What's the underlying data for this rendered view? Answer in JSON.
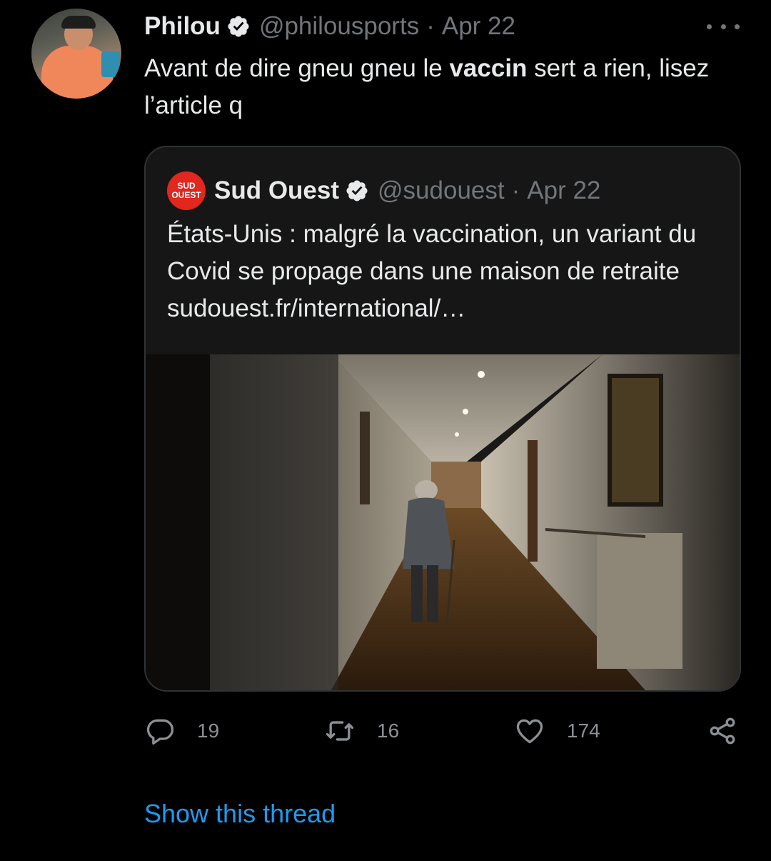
{
  "tweet": {
    "author_name": "Philou",
    "author_handle": "@philousports",
    "separator": "·",
    "date": "Apr 22",
    "text_before": "Avant de dire gneu gneu le ",
    "text_bold": "vaccin",
    "text_after": " sert a rien, lisez l’article q"
  },
  "quoted": {
    "logo_line1": "SUD",
    "logo_line2": "OUEST",
    "author_name": "Sud Ouest",
    "author_handle": "@sudouest",
    "separator": "·",
    "date": "Apr 22",
    "text": "États-Unis : malgré la vaccination, un variant du Covid se propage dans une maison de retraite sudouest.fr/international/…"
  },
  "actions": {
    "replies": "19",
    "retweets": "16",
    "likes": "174"
  },
  "show_thread": "Show this thread",
  "colors": {
    "background": "#000000",
    "text": "#e7e9ea",
    "secondary": "#71767b",
    "link": "#1d9bf0",
    "verified": "#e7e9ea",
    "sud_ouest_red": "#e1271e"
  },
  "icons": [
    "more-icon",
    "verified-badge-icon",
    "reply-icon",
    "retweet-icon",
    "like-icon",
    "share-icon"
  ]
}
